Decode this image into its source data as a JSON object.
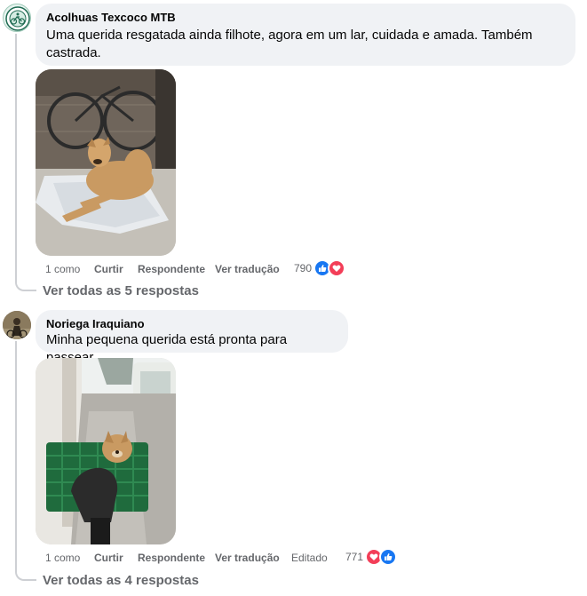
{
  "comments": [
    {
      "author": "Acolhuas Texcoco MTB",
      "text": "Uma querida resgatada ainda filhote, agora em um lar, cuidada e amada. Também castrada.",
      "actions": {
        "like": "1 como",
        "curtir": "Curtir",
        "reply": "Respondente",
        "translate": "Ver tradução"
      },
      "reaction_count": "790",
      "reactions": [
        "like-icon",
        "love-icon"
      ],
      "view_replies": "Ver todas as 5 respostas"
    },
    {
      "author": "Noriega Iraquiano",
      "text": "Minha pequena querida está pronta para passear.",
      "actions": {
        "like": "1 como",
        "curtir": "Curtir",
        "reply": "Respondente",
        "translate": "Ver tradução",
        "edited": "Editado"
      },
      "reaction_count": "771",
      "reactions": [
        "love-icon",
        "like-icon"
      ],
      "view_replies": "Ver todas as 4 respostas"
    }
  ],
  "colors": {
    "bubble": "#f0f2f5",
    "secondary_text": "#65676b",
    "like_blue": "#1877f2",
    "love_red": "#f33e58",
    "thread_line": "#ced0d4"
  }
}
